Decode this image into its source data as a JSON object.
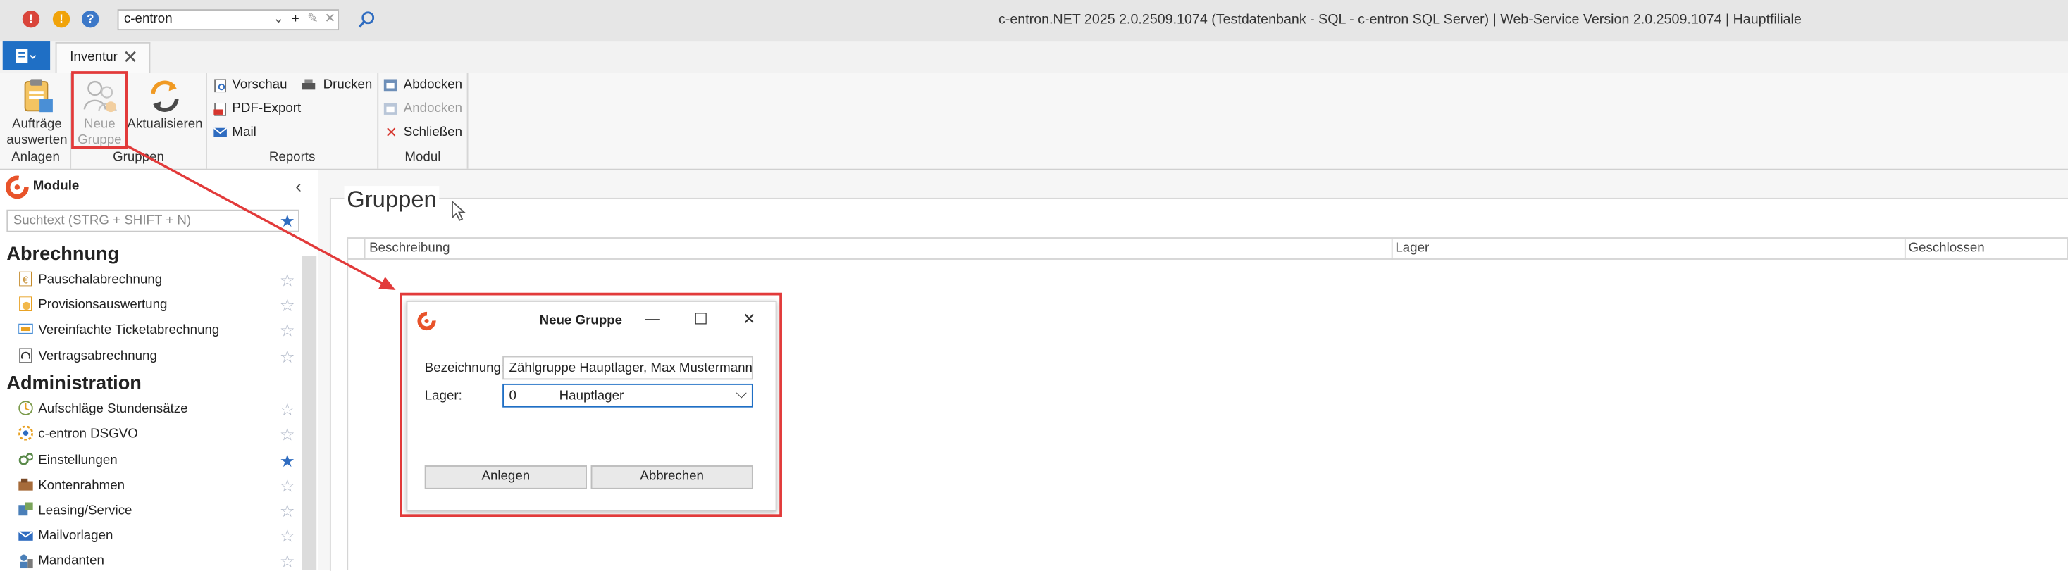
{
  "titlebar": {
    "search_combo_value": "c-entron",
    "window_title": "c-entron.NET 2025 2.0.2509.1074 (Testdatenbank - SQL - c-entron SQL Server) | Web-Service Version 2.0.2509.1074 | Hauptfiliale",
    "icon_warning_glyph": "!",
    "icon_info_glyph": "!",
    "icon_help_glyph": "?"
  },
  "tabs": {
    "active_label": "Inventur",
    "close_glyph": "✕"
  },
  "ribbon": {
    "groups": {
      "anlagen": "Anlagen",
      "gruppen": "Gruppen",
      "reports": "Reports",
      "modul": "Modul"
    },
    "auftraege_auswerten_line1": "Aufträge",
    "auftraege_auswerten_line2": "auswerten",
    "neue_gruppe_line1": "Neue",
    "neue_gruppe_line2": "Gruppe",
    "aktualisieren": "Aktualisieren",
    "vorschau": "Vorschau",
    "drucken": "Drucken",
    "pdf_export": "PDF-Export",
    "mail": "Mail",
    "abdocken": "Abdocken",
    "andocken": "Andocken",
    "schliessen": "Schließen"
  },
  "module_pane": {
    "title": "Module",
    "collapse_glyph": "‹",
    "search_placeholder": "Suchtext (STRG + SHIFT + N)",
    "sections": [
      {
        "title": "Abrechnung",
        "items": [
          {
            "label": "Pauschalabrechnung",
            "favorite": false
          },
          {
            "label": "Provisionsauswertung",
            "favorite": false
          },
          {
            "label": "Vereinfachte Ticketabrechnung",
            "favorite": false
          },
          {
            "label": "Vertragsabrechnung",
            "favorite": false
          }
        ]
      },
      {
        "title": "Administration",
        "items": [
          {
            "label": "Aufschläge Stundensätze",
            "favorite": false
          },
          {
            "label": "c-entron DSGVO",
            "favorite": false
          },
          {
            "label": "Einstellungen",
            "favorite": true
          },
          {
            "label": "Kontenrahmen",
            "favorite": false
          },
          {
            "label": "Leasing/Service",
            "favorite": false
          },
          {
            "label": "Mailvorlagen",
            "favorite": false
          },
          {
            "label": "Mandanten",
            "favorite": false
          }
        ]
      }
    ]
  },
  "main": {
    "panel_title": "Gruppen",
    "columns": [
      "Beschreibung",
      "Lager",
      "Geschlossen"
    ]
  },
  "dialog": {
    "title": "Neue Gruppe",
    "minimize_glyph": "—",
    "maximize_glyph": "☐",
    "close_glyph": "✕",
    "bezeichnung_label": "Bezeichnung:",
    "bezeichnung_value": "Zählgruppe Hauptlager, Max Mustermann",
    "lager_label": "Lager:",
    "lager_number": "0",
    "lager_name": "Hauptlager",
    "dropdown_glyph": "⌵",
    "anlegen_button": "Anlegen",
    "abbrechen_button": "Abbrechen"
  },
  "colors": {
    "accent_blue": "#1f6fc5",
    "annotation_red": "#e23a3a",
    "brand_orange": "#e8532a"
  }
}
